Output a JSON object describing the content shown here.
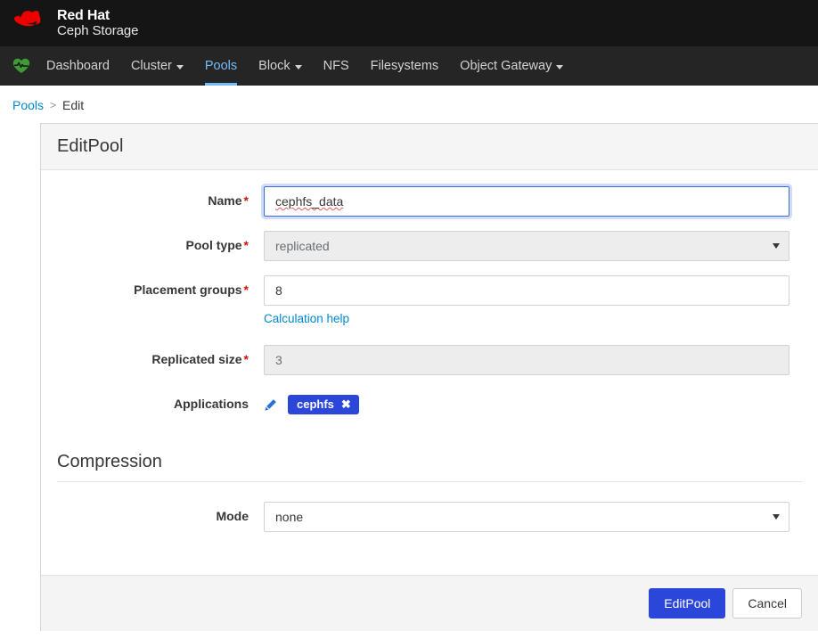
{
  "brand": {
    "logo_icon": "red-hat-fedora-logo",
    "line1": "Red Hat",
    "line2": "Ceph Storage"
  },
  "nav": {
    "health_icon": "heart-pulse-icon",
    "items": [
      {
        "label": "Dashboard",
        "has_caret": false,
        "active": false
      },
      {
        "label": "Cluster",
        "has_caret": true,
        "active": false
      },
      {
        "label": "Pools",
        "has_caret": false,
        "active": true
      },
      {
        "label": "Block",
        "has_caret": true,
        "active": false
      },
      {
        "label": "NFS",
        "has_caret": false,
        "active": false
      },
      {
        "label": "Filesystems",
        "has_caret": false,
        "active": false
      },
      {
        "label": "Object Gateway",
        "has_caret": true,
        "active": false
      }
    ]
  },
  "breadcrumb": {
    "parent": "Pools",
    "separator": ">",
    "current": "Edit"
  },
  "card": {
    "title": "EditPool",
    "fields": {
      "name": {
        "label": "Name",
        "required": "*",
        "value": "cephfs_data",
        "placeholder": "Name..."
      },
      "pool_type": {
        "label": "Pool type",
        "required": "*",
        "value": "replicated",
        "disabled": true
      },
      "placement_groups": {
        "label": "Placement groups",
        "required": "*",
        "value": "8",
        "help_link": "Calculation help"
      },
      "replicated_size": {
        "label": "Replicated size",
        "required": "*",
        "value": "3",
        "disabled": true
      },
      "applications": {
        "label": "Applications",
        "edit_icon": "pencil-icon",
        "badges": [
          {
            "label": "cephfs",
            "close_icon": "✖"
          }
        ]
      }
    },
    "compression": {
      "title": "Compression",
      "mode": {
        "label": "Mode",
        "value": "none"
      }
    },
    "footer": {
      "submit_label": "EditPool",
      "cancel_label": "Cancel"
    }
  },
  "colors": {
    "masthead_bg": "#151515",
    "navbar_bg": "#252525",
    "nav_active": "#73bcf7",
    "link_blue": "#0088ce",
    "primary_blue": "#2b47d9",
    "required_red": "#c9190b",
    "health_green": "#3f9c35"
  }
}
